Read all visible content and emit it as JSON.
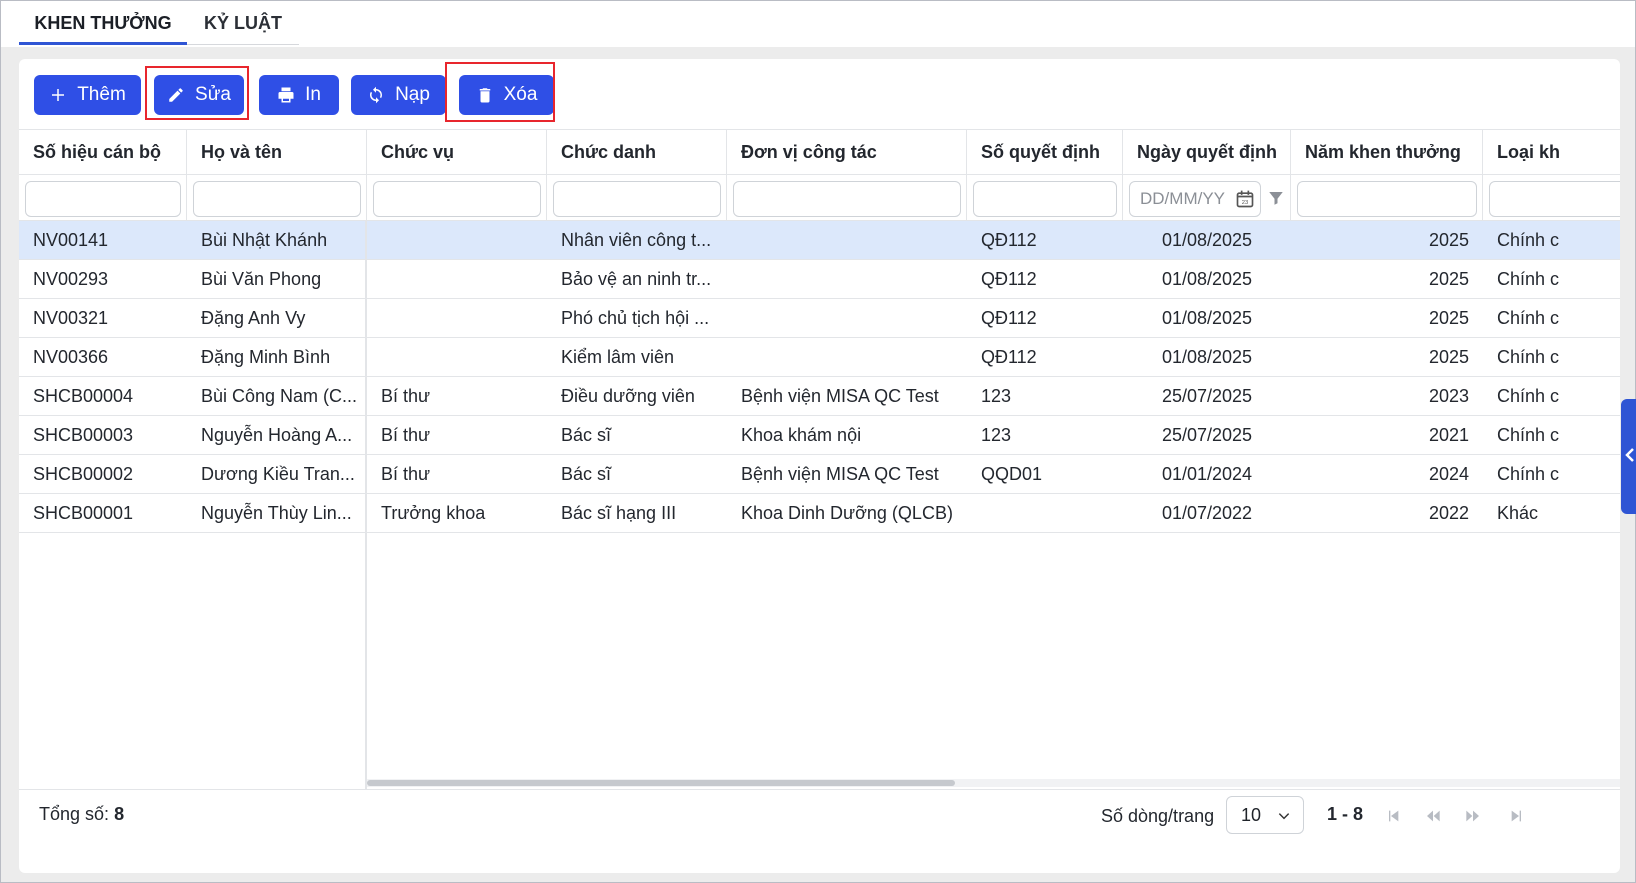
{
  "tabs": [
    {
      "label": "KHEN THƯỞNG",
      "active": true
    },
    {
      "label": "KỶ LUẬT",
      "active": false
    }
  ],
  "toolbar": {
    "add_label": "Thêm",
    "edit_label": "Sửa",
    "print_label": "In",
    "reload_label": "Nạp",
    "delete_label": "Xóa"
  },
  "table": {
    "columns": [
      "Số hiệu cán bộ",
      "Họ và tên",
      "Chức vụ",
      "Chức danh",
      "Đơn vị công tác",
      "Số quyết định",
      "Ngày quyết định",
      "Năm khen thưởng",
      "Loại kh"
    ],
    "date_filter_placeholder": "DD/MM/YY",
    "rows": [
      [
        "NV00141",
        "Bùi Nhật Khánh",
        "",
        "Nhân viên công t...",
        "",
        "QĐ112",
        "01/08/2025",
        "2025",
        "Chính c"
      ],
      [
        "NV00293",
        "Bùi Văn Phong",
        "",
        "Bảo vệ an ninh tr...",
        "",
        "QĐ112",
        "01/08/2025",
        "2025",
        "Chính c"
      ],
      [
        "NV00321",
        "Đặng Anh Vy",
        "",
        "Phó chủ tịch hội ...",
        "",
        "QĐ112",
        "01/08/2025",
        "2025",
        "Chính c"
      ],
      [
        "NV00366",
        "Đặng Minh Bình",
        "",
        "Kiểm lâm viên",
        "",
        "QĐ112",
        "01/08/2025",
        "2025",
        "Chính c"
      ],
      [
        "SHCB00004",
        "Bùi Công Nam (C...",
        "Bí thư",
        "Điều dưỡng viên",
        "Bệnh viện MISA QC Test",
        "123",
        "25/07/2025",
        "2023",
        "Chính c"
      ],
      [
        "SHCB00003",
        "Nguyễn Hoàng A...",
        "Bí thư",
        "Bác sĩ",
        "Khoa khám nội",
        "123",
        "25/07/2025",
        "2021",
        "Chính c"
      ],
      [
        "SHCB00002",
        "Dương Kiều Tran...",
        "Bí thư",
        "Bác sĩ",
        "Bệnh viện MISA QC Test",
        "QQD01",
        "01/01/2024",
        "2024",
        "Chính c"
      ],
      [
        "SHCB00001",
        "Nguyễn Thùy Lin...",
        "Trưởng khoa",
        "Bác sĩ hạng III",
        "Khoa Dinh Dưỡng (QLCB)",
        "",
        "01/07/2022",
        "2022",
        "Khác"
      ]
    ],
    "selected_row": 0
  },
  "footer": {
    "total_label": "Tổng số:",
    "total_value": "8",
    "rows_per_page_label": "Số dòng/trang",
    "rows_per_page_value": "10",
    "range": "1 - 8"
  },
  "colors": {
    "primary": "#2f4fe6",
    "selected_row": "#dce8fb",
    "highlight_box": "#e8262d"
  }
}
